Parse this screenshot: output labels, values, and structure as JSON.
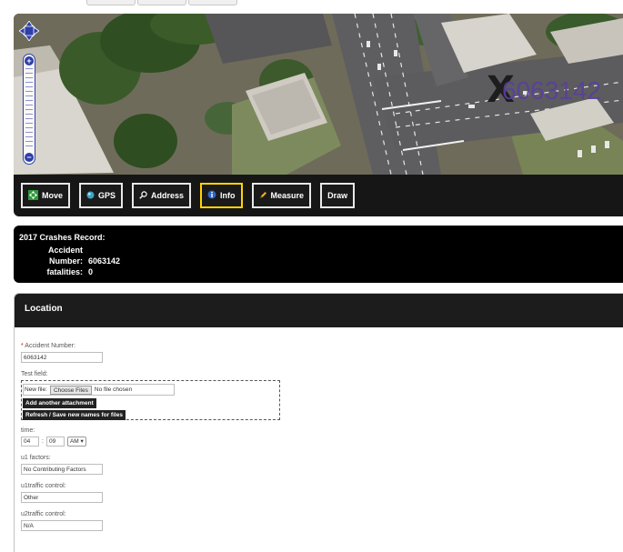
{
  "toolbar": {
    "buttons": [
      {
        "label": "Move",
        "icon": "move-arrows-icon"
      },
      {
        "label": "GPS",
        "icon": "gps-icon"
      },
      {
        "label": "Address",
        "icon": "search-icon"
      },
      {
        "label": "Info",
        "icon": "info-icon",
        "active": true
      },
      {
        "label": "Measure",
        "icon": "pencil-icon"
      },
      {
        "label": "Draw",
        "icon": null
      }
    ]
  },
  "map": {
    "marker_label": "6063142",
    "marker_symbol": "X"
  },
  "record": {
    "title": "2017 Crashes Record:",
    "rows": [
      {
        "key": "Accident",
        "value": ""
      },
      {
        "key": "Number:",
        "value": "6063142"
      },
      {
        "key": "fatalities:",
        "value": "0"
      }
    ]
  },
  "location": {
    "title": "Location",
    "accident_number": {
      "required_mark": "*",
      "label": "Accident Number:",
      "value": "6063142"
    },
    "test_field": {
      "label": "Test field:",
      "new_file_label": "New file:",
      "choose_files_label": "Choose Files",
      "no_file_text": "No file chosen",
      "add_attachment_label": "Add another attachment",
      "refresh_label": "Refresh / Save new names for files"
    },
    "time": {
      "label": "time:",
      "hour": "04",
      "separator": ":",
      "minute": "09",
      "ampm": "AM"
    },
    "u1_factors": {
      "label": "u1 factors:",
      "value": "No Contributing Factors"
    },
    "u1_traffic_control": {
      "label": "u1traffic control:",
      "value": "Other"
    },
    "u2_traffic_control": {
      "label": "u2traffic control:",
      "value": "N/A"
    }
  },
  "colors": {
    "panel_bg": "#161616",
    "active_button_border": "#ffd400",
    "marker_label": "#5a3f9e",
    "required": "#dd0000"
  }
}
